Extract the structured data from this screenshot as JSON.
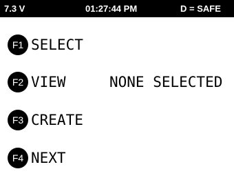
{
  "status_bar": {
    "voltage": "7.3 V",
    "time": "01:27:44 PM",
    "mode": "D = SAFE"
  },
  "menu": {
    "items": [
      {
        "key": "F1",
        "label": "SELECT"
      },
      {
        "key": "F2",
        "label": "VIEW",
        "value": "NONE SELECTED"
      },
      {
        "key": "F3",
        "label": "CREATE"
      },
      {
        "key": "F4",
        "label": "NEXT"
      }
    ]
  },
  "colors": {
    "status_bar_bg": "#000000",
    "status_bar_text": "#ffffff",
    "background": "#ffffff",
    "fkey_badge": "#000000",
    "text": "#000000"
  }
}
